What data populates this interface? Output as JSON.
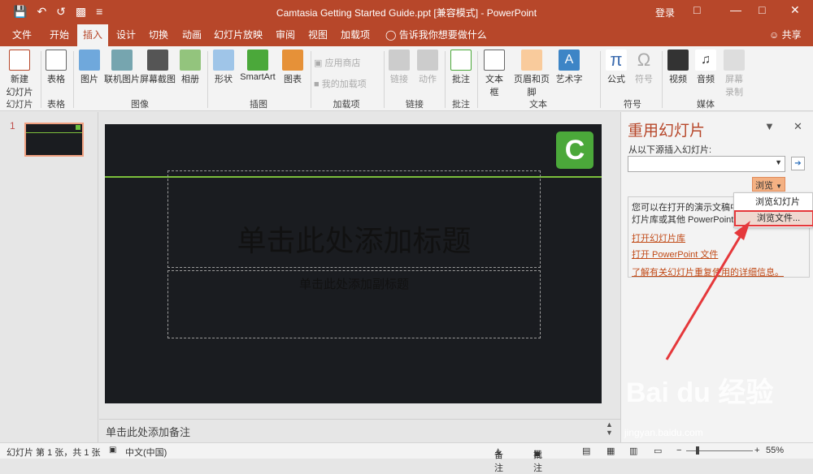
{
  "titlebar": {
    "title": "Camtasia Getting Started Guide.ppt [兼容模式] - PowerPoint",
    "login": "登录",
    "min_icon": "minimize-icon",
    "restore_icon": "restore-icon",
    "close_icon": "close-icon"
  },
  "tabs": [
    "文件",
    "开始",
    "插入",
    "设计",
    "切换",
    "动画",
    "幻灯片放映",
    "审阅",
    "视图",
    "加载项"
  ],
  "tell_me": "告诉我你想要做什么",
  "share": "共享",
  "ribbon": {
    "new_slide": "新建\n幻灯片",
    "table": "表格",
    "picture": "图片",
    "online_picture": "联机图片",
    "screenshot": "屏幕截图",
    "album": "相册",
    "shapes": "形状",
    "smartart": "SmartArt",
    "chart": "图表",
    "store": "应用商店",
    "my_addins": "我的加载项",
    "link": "链接",
    "action": "动作",
    "comment": "批注",
    "textbox": "文本框",
    "header_footer": "页眉和页脚",
    "wordart": "艺术字",
    "equation": "公式",
    "symbol": "符号",
    "video": "视频",
    "audio": "音频",
    "screen_record": "屏幕\n录制",
    "groups": {
      "slides": "幻灯片",
      "tables": "表格",
      "images": "图像",
      "illustrations": "插图",
      "addins": "加载项",
      "links": "链接",
      "comments": "批注",
      "text": "文本",
      "symbols": "符号",
      "media": "媒体"
    }
  },
  "thumbnail": {
    "number": "1"
  },
  "slide": {
    "title_placeholder": "单击此处添加标题",
    "subtitle_placeholder": "单击此处添加副标题"
  },
  "notes": "单击此处添加备注",
  "pane": {
    "title": "重用幻灯片",
    "label": "从以下源插入幻灯片:",
    "browse": "浏览",
    "info_line1": "您可以在打开的演示文稿中",
    "info_line2": "灯片库或其他 PowerPoint",
    "link1": "打开幻灯片库",
    "link2": "打开 PowerPoint 文件",
    "link3": "了解有关幻灯片重复使用的详细信息。"
  },
  "browse_menu": {
    "item1": "浏览幻灯片库...",
    "item2": "浏览文件..."
  },
  "status": {
    "slide_info": "幻灯片 第 1 张，共 1 张",
    "language": "中文(中国)",
    "notes": "备注",
    "comments": "批注",
    "zoom": "55%"
  },
  "watermark": {
    "brand": "Bai du 经验",
    "url": "jingyan.baidu.com"
  },
  "colors": {
    "accent": "#b7472a",
    "slide_bg": "#1a1c20",
    "green": "#7cbf3c",
    "highlight": "#e5383b"
  }
}
